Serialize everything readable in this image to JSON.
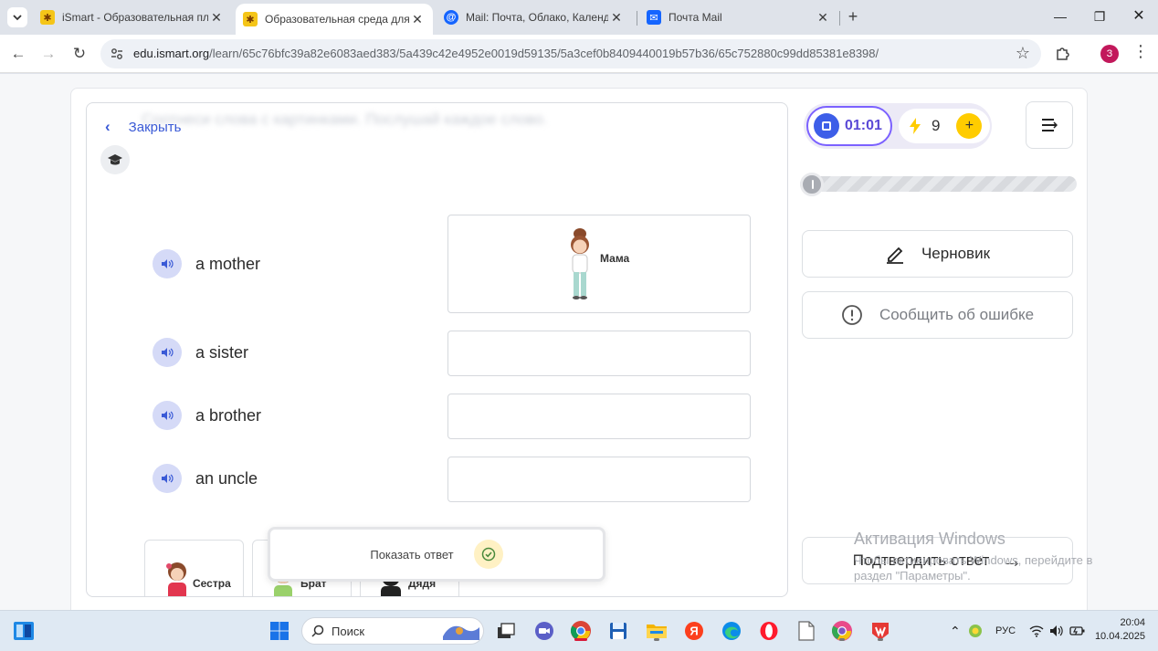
{
  "browser": {
    "tabs": [
      {
        "title": "iSmart - Образовательная пла",
        "active": false
      },
      {
        "title": "Образовательная среда для с",
        "active": true
      },
      {
        "title": "Mail: Почта, Облако, Календар",
        "active": false
      },
      {
        "title": "Почта Mail",
        "active": false
      }
    ],
    "url_host": "edu.ismart.org",
    "url_path": "/learn/65c76bfc39a82e6083aed383/5a439c42e4952e0019d59135/5a3cef0b8409440019b57b36/65c752880c99dd85381e8398/",
    "profile_initial": "З"
  },
  "task": {
    "close_label": "Закрыть",
    "blurred_title": "Соотнеси слова с картинками. Послушай каждое слово.",
    "words": [
      "a mother",
      "a sister",
      "a brother",
      "an uncle"
    ],
    "placed_caption": "Мама",
    "bank_cards": [
      "Сестра",
      "Брат",
      "Дядя"
    ],
    "show_answer_label": "Показать ответ"
  },
  "sidebar": {
    "timer": "01:01",
    "energy": "9",
    "draft_label": "Черновик",
    "report_label": "Сообщить об ошибке",
    "confirm_label": "Подтвердить ответ",
    "progress_value": 0
  },
  "watermark": {
    "line1": "Активация Windows",
    "line2": "Чтобы активировать Windows, перейдите в раздел \"Параметры\"."
  },
  "taskbar": {
    "search_placeholder": "Поиск",
    "lang": "РУС",
    "time": "20:04",
    "date": "10.04.2025"
  },
  "colors": {
    "accent": "#3a5ad6",
    "timer_border": "#7b61ff",
    "energy_plus": "#ffcc00",
    "speaker_bg": "#d5daf7"
  }
}
